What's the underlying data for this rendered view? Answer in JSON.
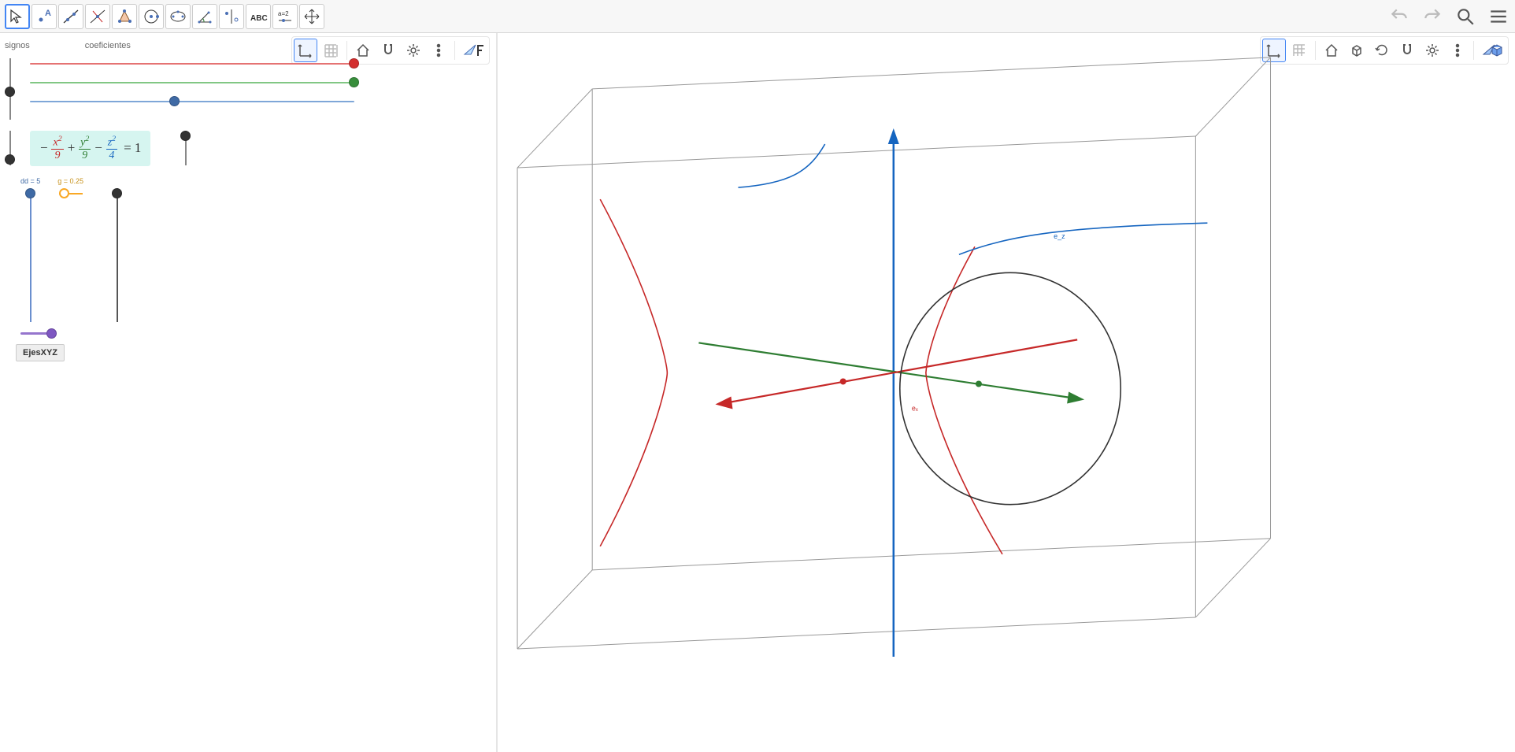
{
  "header": {
    "labels": {
      "signos": "signos",
      "coeficientes": "coeficientes"
    }
  },
  "equation": {
    "sign1": "−",
    "term1": {
      "num": "x",
      "den": "9",
      "color": "#c62828"
    },
    "sign2": "+",
    "term2": {
      "num": "y",
      "den": "9",
      "color": "#2e7d32"
    },
    "sign3": "−",
    "term3": {
      "num": "z",
      "den": "4",
      "color": "#1565c0"
    },
    "rhs": "= 1"
  },
  "sliders": {
    "red": {
      "value": 1.0,
      "color": "#e57373"
    },
    "green": {
      "value": 1.0,
      "color": "#81c784"
    },
    "blue": {
      "value": 0.45,
      "color": "#7fa7d8"
    },
    "sign_v1": {
      "value": 0.5
    },
    "sign_v2": {
      "value": 0.1
    },
    "right_v": {
      "value": 0.05
    },
    "dd": {
      "label": "dd = 5",
      "value": 0.0,
      "color": "#6a8fce"
    },
    "g": {
      "label": "g = 0.25",
      "value": 0.0,
      "color": "#f9a825"
    },
    "black_v": {
      "value": 0.0
    },
    "purple": {
      "value": 1.0,
      "color": "#9575cd"
    }
  },
  "button": {
    "ejes": "EjesXYZ"
  },
  "scene": {
    "labels": {
      "ex": "eₓ",
      "ez": "e_z"
    }
  },
  "mini_toolbar_left": [
    "axes",
    "grid",
    "home",
    "magnet",
    "gear",
    "dots",
    "style"
  ],
  "mini_toolbar_right": [
    "axes",
    "grid",
    "home",
    "cube",
    "rotate",
    "magnet",
    "gear",
    "dots",
    "style3d"
  ],
  "colors": {
    "x_axis": "#c62828",
    "y_axis": "#2e7d32",
    "z_axis": "#1565c0",
    "box": "#888888"
  }
}
